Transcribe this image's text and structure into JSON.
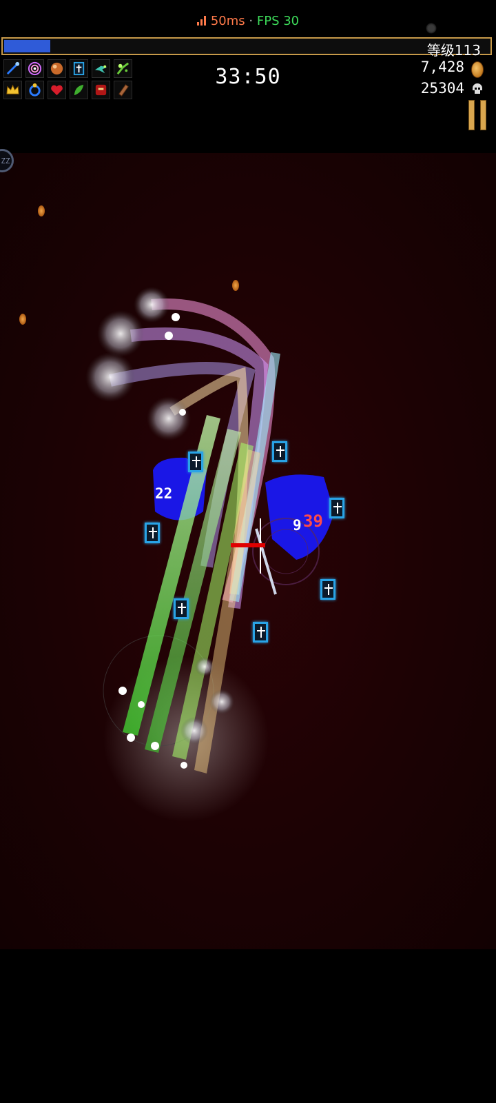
{
  "status": {
    "ping": "50ms",
    "separator": "·",
    "fps": "FPS 30"
  },
  "hud": {
    "level": "等级113",
    "xp_progress": 0.095,
    "timer": "33:50",
    "gold": "7,428",
    "kills": "25304",
    "weapon_icons": [
      "magic-wand-icon",
      "runetracer-icon",
      "fire-wand-icon",
      "king-bible-icon",
      "peachone-icon",
      "song-of-mana-icon"
    ],
    "passive_icons": [
      "crown-icon",
      "attractorb-icon",
      "hollow-heart-icon",
      "spinach-icon",
      "empty-tome-icon",
      "bracer-icon"
    ],
    "side_button": "ZZ"
  },
  "arena": {
    "damage_numbers": [
      "22",
      "9",
      "39"
    ]
  },
  "colors": {
    "xp_fill": "#2f5bd8",
    "xp_border": "#c79a4a",
    "ping": "#ff7a4a",
    "fps": "#3ddc5a",
    "floor": "#1c0204",
    "bible_glow": "#29a3e6"
  }
}
